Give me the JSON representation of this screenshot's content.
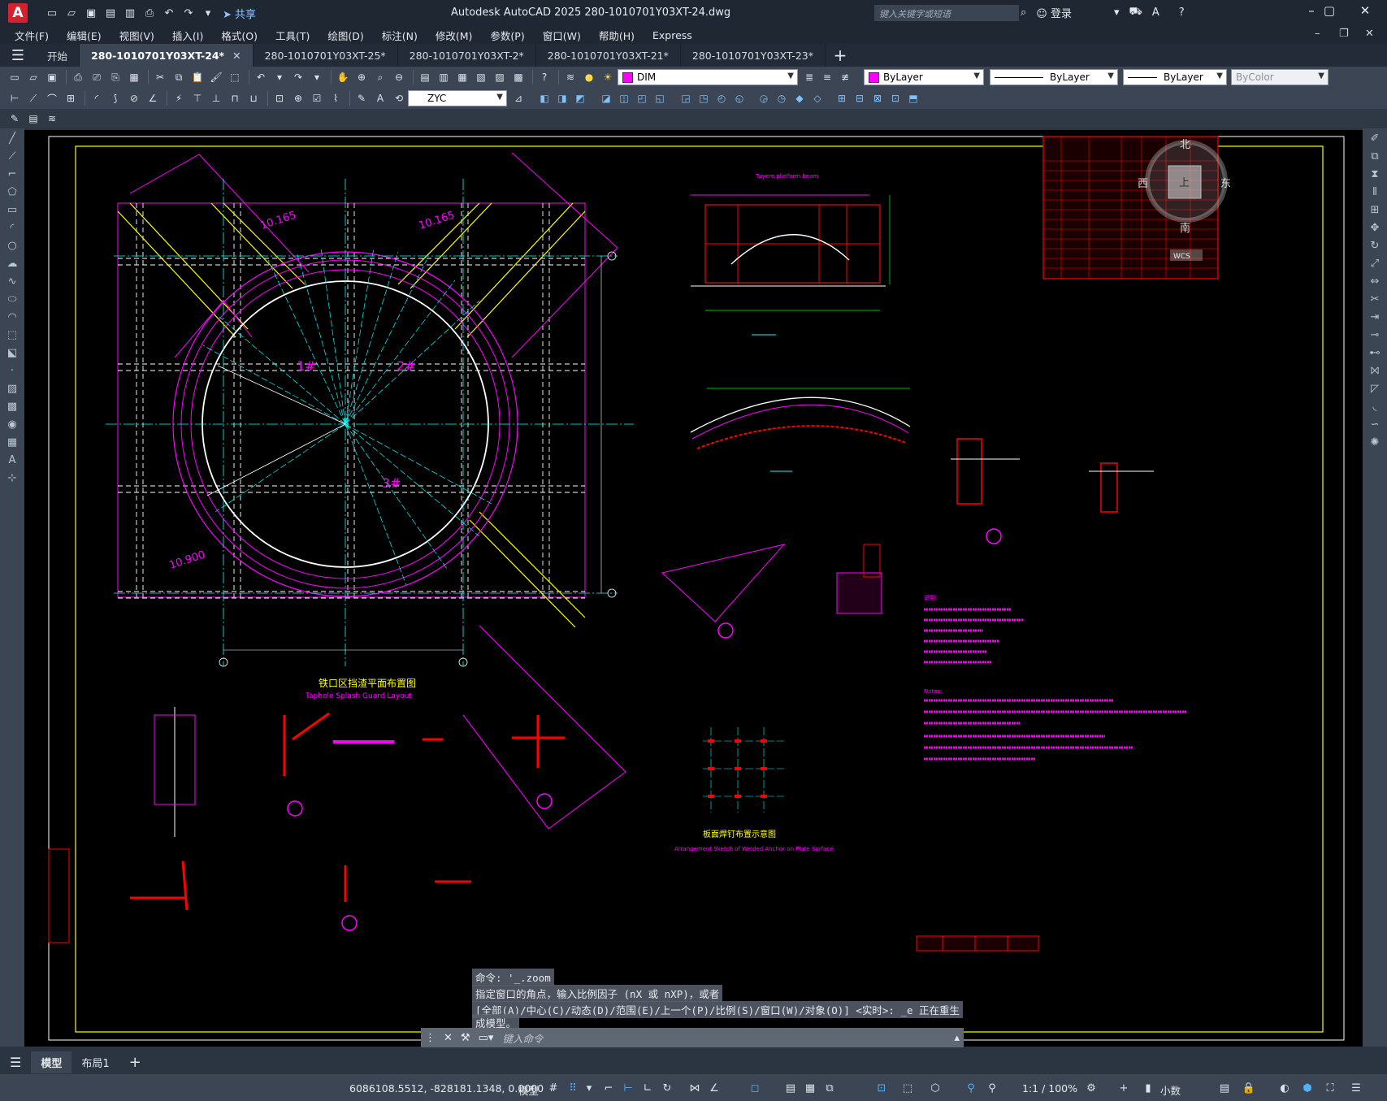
{
  "titlebar": {
    "logo": "A",
    "share_label": "共享",
    "title": "Autodesk AutoCAD 2025    280-1010701Y03XT-24.dwg",
    "search_placeholder": "键入关键字或短语",
    "login_label": "登录"
  },
  "menu": [
    "文件(F)",
    "编辑(E)",
    "视图(V)",
    "插入(I)",
    "格式(O)",
    "工具(T)",
    "绘图(D)",
    "标注(N)",
    "修改(M)",
    "参数(P)",
    "窗口(W)",
    "帮助(H)",
    "Express"
  ],
  "tabs": [
    {
      "label": "开始",
      "active": false,
      "close": false
    },
    {
      "label": "280-1010701Y03XT-24*",
      "active": true,
      "close": true
    },
    {
      "label": "280-1010701Y03XT-25*",
      "active": false,
      "close": false
    },
    {
      "label": "280-1010701Y03XT-2*",
      "active": false,
      "close": false
    },
    {
      "label": "280-1010701Y03XT-21*",
      "active": false,
      "close": false
    },
    {
      "label": "280-1010701Y03XT-23*",
      "active": false,
      "close": false
    }
  ],
  "toolbar": {
    "layer_value": "DIM",
    "color_value": "ByLayer",
    "linetype_value": "ByLayer",
    "lineweight_value": "ByLayer",
    "plotstyle_value": "ByColor",
    "dimstyle_value": "ZYC"
  },
  "viewcube": {
    "north": "北",
    "south": "南",
    "east": "东",
    "west": "西",
    "face": "上",
    "wcs": "WCS"
  },
  "drawing": {
    "elev1": "10.165",
    "elev2": "10.165",
    "elev3": "10.900",
    "zone1": "1#",
    "zone2": "2#",
    "zone3": "3#",
    "main_title_cn": "铁口区挡渣平面布置图",
    "main_title_en": "Taphole Splash Guard Layout",
    "sub_title_cn": "板面焊钉布置示意图",
    "sub_title_en": "Arrangement Sketch of Welded Anchor on Plate Surface",
    "platform_label": "Tuyere platform beam",
    "notes_cn_title": "说明：",
    "notes_en_title": "Notes:"
  },
  "command": {
    "history1": "命令: '_.zoom",
    "history2": "指定窗口的角点，输入比例因子 (nX 或 nXP)，或者",
    "history3": "[全部(A)/中心(C)/动态(D)/范围(E)/上一个(P)/比例(S)/窗口(W)/对象(O)] <实时>: _e 正在重生",
    "history4": "成模型。",
    "placeholder": "键入命令"
  },
  "layouts": [
    {
      "label": "模型",
      "active": true
    },
    {
      "label": "布局1",
      "active": false
    }
  ],
  "status": {
    "coords": "6086108.5512, -828181.1348, 0.0000",
    "model_label": "模型",
    "scale": "1:1 / 100%",
    "units": "小数"
  }
}
